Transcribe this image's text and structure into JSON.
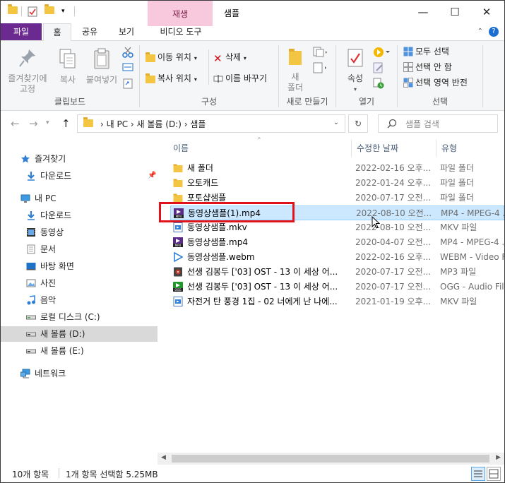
{
  "window": {
    "title": "샘플",
    "context_tab": "재생",
    "min": "—",
    "max": "☐",
    "close": "✕"
  },
  "tabs": [
    "파일",
    "홈",
    "공유",
    "보기",
    "비디오 도구"
  ],
  "ribbon": {
    "pin_label": "즐겨찾기에\n고정",
    "copy_label": "복사",
    "paste_label": "붙여넣기",
    "clipboard_group": "클립보드",
    "move_to": "이동 위치",
    "copy_to": "복사 위치",
    "delete": "삭제",
    "rename": "이름 바꾸기",
    "organize_group": "구성",
    "new_folder": "새\n폴더",
    "new_group": "새로 만들기",
    "properties": "속성",
    "open_group": "열기",
    "select_all": "모두 선택",
    "select_none": "선택 안 함",
    "invert_selection": "선택 영역 반전",
    "select_group": "선택"
  },
  "address": {
    "crumbs": "›  내 PC  ›  새 볼륨 (D:)  ›  샘플",
    "search_placeholder": "샘플 검색"
  },
  "nav": [
    {
      "label": "즐겨찾기",
      "icon": "star-icon"
    },
    {
      "label": "다운로드",
      "icon": "download-icon"
    },
    {
      "label": "내 PC",
      "icon": "pc-icon"
    },
    {
      "label": "다운로드",
      "icon": "download-icon"
    },
    {
      "label": "동영상",
      "icon": "video-icon"
    },
    {
      "label": "문서",
      "icon": "document-icon"
    },
    {
      "label": "바탕 화면",
      "icon": "desktop-icon"
    },
    {
      "label": "사진",
      "icon": "picture-icon"
    },
    {
      "label": "음악",
      "icon": "music-icon"
    },
    {
      "label": "로컬 디스크 (C:)",
      "icon": "drive-icon"
    },
    {
      "label": "새 볼륨 (D:)",
      "icon": "drive-icon"
    },
    {
      "label": "새 볼륨 (E:)",
      "icon": "drive-icon"
    },
    {
      "label": "네트워크",
      "icon": "network-icon"
    }
  ],
  "columns": {
    "name": "이름",
    "date": "수정한 날짜",
    "type": "유형"
  },
  "files": [
    {
      "name": "새 폴더",
      "date": "2022-02-16 오후...",
      "type": "파일 폴더",
      "icon": "folder-icon"
    },
    {
      "name": "오토캐드",
      "date": "2022-01-24 오후...",
      "type": "파일 폴더",
      "icon": "folder-icon"
    },
    {
      "name": "포토샵샘플",
      "date": "2020-07-17 오전...",
      "type": "파일 폴더",
      "icon": "folder-icon"
    },
    {
      "name": "동영상샘플(1).mp4",
      "date": "2022-08-10 오전...",
      "type": "MP4 - MPEG-4 ...",
      "icon": "mp4-file-icon"
    },
    {
      "name": "동영상샘플.mkv",
      "date": "2022-08-10 오전...",
      "type": "MKV 파일",
      "icon": "mkv-file-icon"
    },
    {
      "name": "동영상샘플.mp4",
      "date": "2020-04-07 오전...",
      "type": "MP4 - MPEG-4 ...",
      "icon": "mp4-file-icon"
    },
    {
      "name": "동영상샘플.webm",
      "date": "2022-02-16 오후...",
      "type": "WEBM - Video F...",
      "icon": "webm-file-icon"
    },
    {
      "name": "선생 김봉두 ['03] OST - 13 이 세상 어...",
      "date": "2020-07-17 오전...",
      "type": "MP3 파일",
      "icon": "mp3-file-icon"
    },
    {
      "name": "선생 김봉두 ['03] OST - 13 이 세상 어...",
      "date": "2020-07-17 오전...",
      "type": "OGG - Audio File",
      "icon": "ogg-file-icon"
    },
    {
      "name": "자전거 탄 풍경 1집 - 02 너에게 난 나에...",
      "date": "2021-01-19 오후...",
      "type": "MKV 파일",
      "icon": "mkv-file-icon"
    }
  ],
  "selected_index": 3,
  "status": {
    "count": "10개 항목",
    "selection": "1개 항목 선택함 5.25MB"
  },
  "colors": {
    "file_tab": "#6b2a8f",
    "context_tab": "#f8c8dc",
    "selection": "#cce8ff",
    "highlight_box": "#e0131b"
  }
}
